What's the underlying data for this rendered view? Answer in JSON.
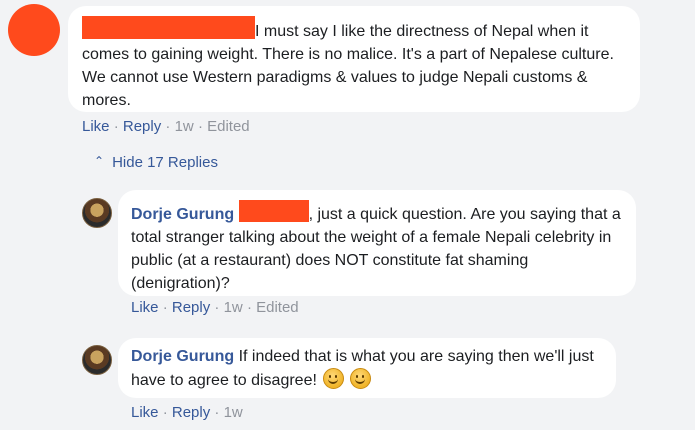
{
  "comment": {
    "text": "I must say I like the directness of Nepal when it comes to gaining weight. There is no malice. It's a part of Nepalese culture. We cannot use Western paradigms & values to judge Nepali customs & mores.",
    "like_label": "Like",
    "reply_label": "Reply",
    "time": "1w",
    "edited": "Edited"
  },
  "replies_toggle": {
    "label": "Hide 17 Replies"
  },
  "replies": [
    {
      "author": "Dorje Gurung",
      "text": ", just a quick question. Are you saying that a total stranger talking about the weight of a female Nepali celebrity in public (at a restaurant) does NOT constitute fat shaming (denigration)?",
      "like_label": "Like",
      "reply_label": "Reply",
      "time": "1w",
      "edited": "Edited"
    },
    {
      "author": "Dorje Gurung",
      "text": "If indeed that is what you are saying then we'll just have to agree to disagree!",
      "like_label": "Like",
      "reply_label": "Reply",
      "time": "1w"
    }
  ],
  "separator": "·",
  "colors": {
    "redaction": "#ff4a1c",
    "link": "#365899",
    "muted": "#90949c",
    "bubble": "#ffffff",
    "background": "#f2f3f5"
  }
}
